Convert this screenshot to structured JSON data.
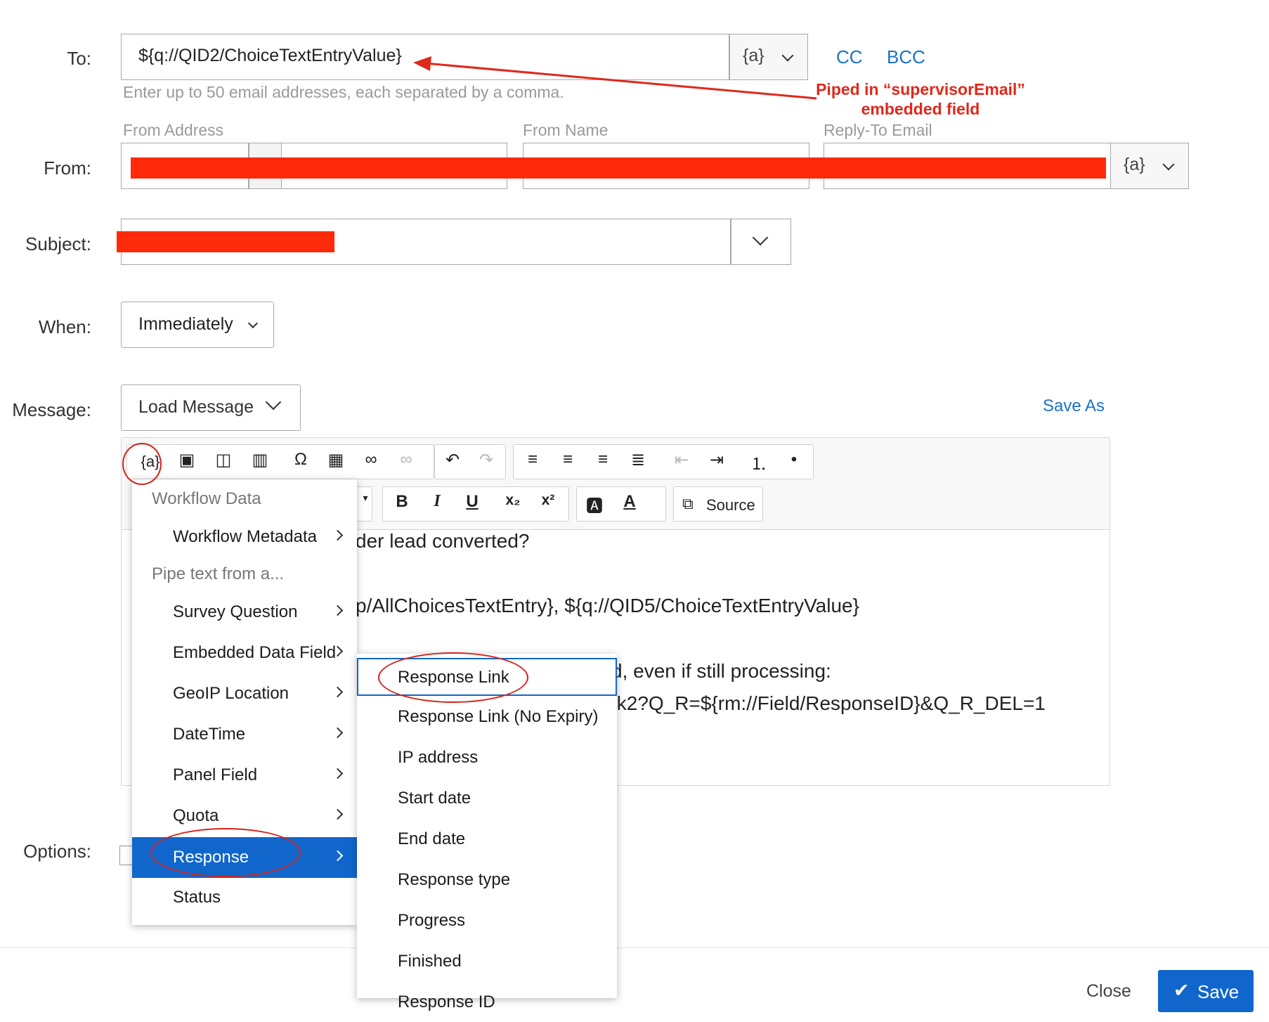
{
  "labels": {
    "to": "To:",
    "from": "From:",
    "subject": "Subject:",
    "when": "When:",
    "message": "Message:",
    "options": "Options:"
  },
  "to": {
    "value": "${q://QID2/ChoiceTextEntryValue}",
    "piping_label": "{a}",
    "cc": "CC",
    "bcc": "BCC",
    "hint": "Enter up to 50 email addresses, each separated by a comma."
  },
  "annotation": {
    "line1": "Piped in “supervisorEmail”",
    "line2": "embedded field",
    "color": "#e0281a"
  },
  "from": {
    "address_label": "From Address",
    "name_label": "From Name",
    "reply_label": "Reply-To Email",
    "piping_label": "{a}"
  },
  "when": {
    "value": "Immediately"
  },
  "message": {
    "load_label": "Load Message",
    "save_as": "Save As",
    "source_label": "Source",
    "piping_label": "{a}",
    "body_lines": [
      "der lead converted?",
      "p/AllChoicesTextEntry}, ${q://QID5/ChoiceTextEntryValue}",
      "d, even if still processing:",
      "fk2?Q_R=${rm://Field/ResponseID}&Q_R_DEL=1"
    ]
  },
  "menu": {
    "items": [
      {
        "label": "Workflow Data",
        "header": true
      },
      {
        "label": "Workflow Metadata",
        "submenu": true
      },
      {
        "label": "Pipe text from a...",
        "header": true
      },
      {
        "label": "Survey Question",
        "submenu": true
      },
      {
        "label": "Embedded Data Field",
        "submenu": true
      },
      {
        "label": "GeoIP Location",
        "submenu": true
      },
      {
        "label": "DateTime",
        "submenu": true
      },
      {
        "label": "Panel Field",
        "submenu": true
      },
      {
        "label": "Quota",
        "submenu": true
      },
      {
        "label": "Response",
        "submenu": true,
        "selected": true
      },
      {
        "label": "Status",
        "submenu": false
      }
    ]
  },
  "submenu": {
    "items": [
      "Response Link",
      "Response Link (No Expiry)",
      "IP address",
      "Start date",
      "End date",
      "Response type",
      "Progress",
      "Finished",
      "Response ID"
    ]
  },
  "footer": {
    "close": "Close",
    "save": "Save"
  },
  "colors": {
    "accent": "#1166cc",
    "link": "#1a73c8",
    "redaction": "#ff2a0a"
  }
}
